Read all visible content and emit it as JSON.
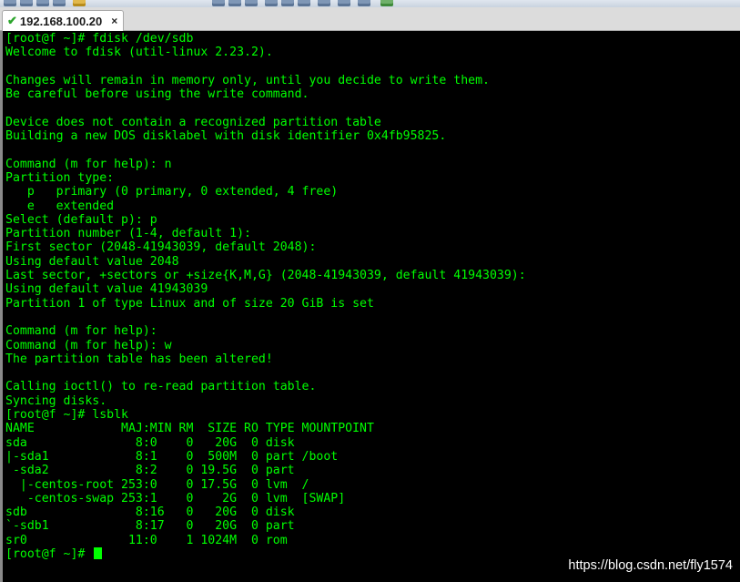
{
  "tab": {
    "title": "192.168.100.20",
    "status_icon": "check-icon",
    "close_glyph": "×"
  },
  "terminal": {
    "lines": [
      "[root@f ~]# fdisk /dev/sdb",
      "Welcome to fdisk (util-linux 2.23.2).",
      "",
      "Changes will remain in memory only, until you decide to write them.",
      "Be careful before using the write command.",
      "",
      "Device does not contain a recognized partition table",
      "Building a new DOS disklabel with disk identifier 0x4fb95825.",
      "",
      "Command (m for help): n",
      "Partition type:",
      "   p   primary (0 primary, 0 extended, 4 free)",
      "   e   extended",
      "Select (default p): p",
      "Partition number (1-4, default 1):",
      "First sector (2048-41943039, default 2048):",
      "Using default value 2048",
      "Last sector, +sectors or +size{K,M,G} (2048-41943039, default 41943039):",
      "Using default value 41943039",
      "Partition 1 of type Linux and of size 20 GiB is set",
      "",
      "Command (m for help):",
      "Command (m for help): w",
      "The partition table has been altered!",
      "",
      "Calling ioctl() to re-read partition table.",
      "Syncing disks.",
      "[root@f ~]# lsblk",
      "NAME            MAJ:MIN RM  SIZE RO TYPE MOUNTPOINT",
      "sda               8:0    0   20G  0 disk",
      "|-sda1            8:1    0  500M  0 part /boot",
      " -sda2            8:2    0 19.5G  0 part",
      "  |-centos-root 253:0    0 17.5G  0 lvm  /",
      "   -centos-swap 253:1    0    2G  0 lvm  [SWAP]",
      "sdb               8:16   0   20G  0 disk",
      "`-sdb1            8:17   0   20G  0 part",
      "sr0              11:0    1 1024M  0 rom"
    ],
    "prompt": "[root@f ~]# "
  },
  "watermark": "https://blog.csdn.net/fly1574",
  "colors": {
    "terminal_bg": "#000000",
    "terminal_fg": "#00ff00",
    "tab_check": "#2ca52c"
  }
}
